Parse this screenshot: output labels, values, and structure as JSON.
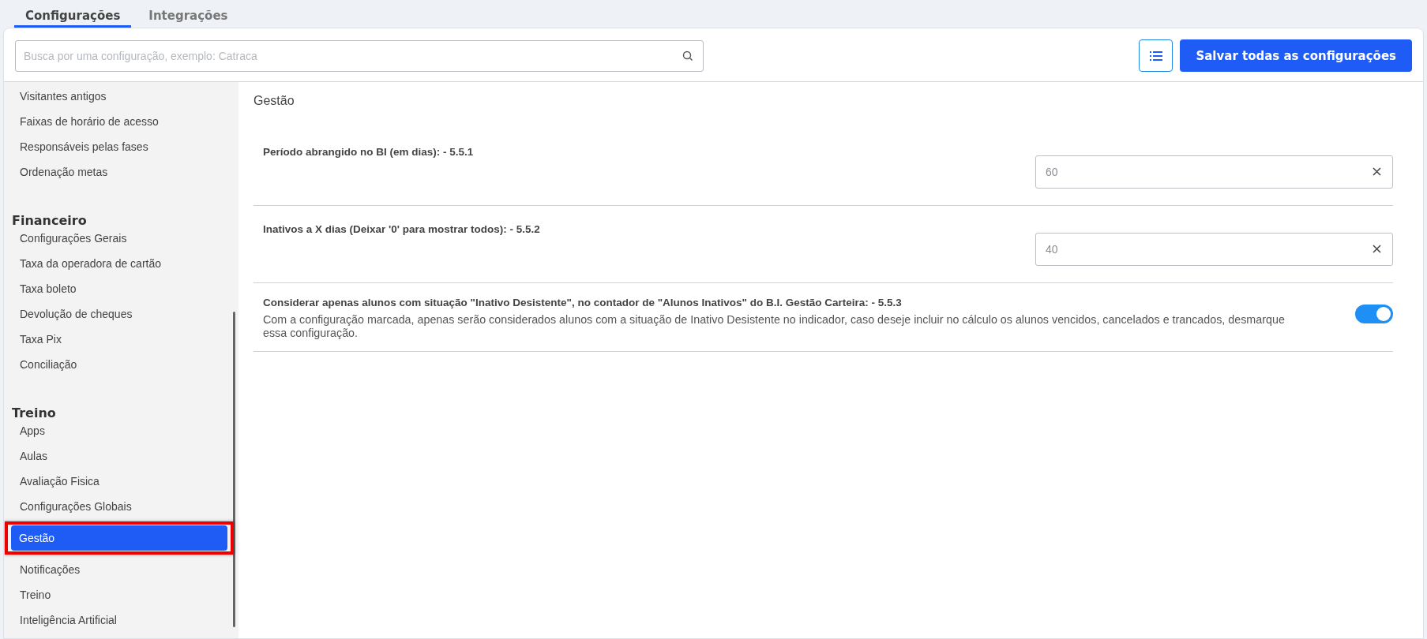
{
  "tabs": [
    {
      "label": "Configurações",
      "selected": true
    },
    {
      "label": "Integrações",
      "selected": false
    }
  ],
  "search": {
    "placeholder": "Busca por uma configuração, exemplo: Catraca"
  },
  "save_button": "Salvar todas as configurações",
  "sidebar": {
    "sections": [
      {
        "items": [
          {
            "label": "Visitantes antigos",
            "selected": false
          },
          {
            "label": "Faixas de horário de acesso",
            "selected": false
          },
          {
            "label": "Responsáveis pelas fases",
            "selected": false
          },
          {
            "label": "Ordenação metas",
            "selected": false
          }
        ]
      },
      {
        "title": "Financeiro",
        "items": [
          {
            "label": "Configurações Gerais",
            "selected": false
          },
          {
            "label": "Taxa da operadora de cartão",
            "selected": false
          },
          {
            "label": "Taxa boleto",
            "selected": false
          },
          {
            "label": "Devolução de cheques",
            "selected": false
          },
          {
            "label": "Taxa Pix",
            "selected": false
          },
          {
            "label": "Conciliação",
            "selected": false
          }
        ]
      },
      {
        "title": "Treino",
        "items": [
          {
            "label": "Apps",
            "selected": false
          },
          {
            "label": "Aulas",
            "selected": false
          },
          {
            "label": "Avaliação Fisica",
            "selected": false
          },
          {
            "label": "Configurações Globais",
            "selected": false
          },
          {
            "label": "Gestão",
            "selected": true
          },
          {
            "label": "Notificações",
            "selected": false
          },
          {
            "label": "Treino",
            "selected": false
          },
          {
            "label": "Inteligência Artificial",
            "selected": false
          }
        ]
      }
    ]
  },
  "content": {
    "title": "Gestão",
    "settings": [
      {
        "kind": "input",
        "label": "Período abrangido no BI (em dias): - 5.5.1",
        "value": "60"
      },
      {
        "kind": "input",
        "label": "Inativos a X dias (Deixar '0' para mostrar todos): - 5.5.2",
        "value": "40"
      },
      {
        "kind": "toggle",
        "label": "Considerar apenas alunos com situação \"Inativo Desistente\", no contador de \"Alunos Inativos\" do B.I. Gestão Carteira: - 5.5.3",
        "description": "Com a configuração marcada, apenas serão considerados alunos com a situação de Inativo Desistente no indicador, caso deseje incluir no cálculo os alunos vencidos, cancelados e trancados, desmarque essa configuração.",
        "on": true
      }
    ]
  }
}
